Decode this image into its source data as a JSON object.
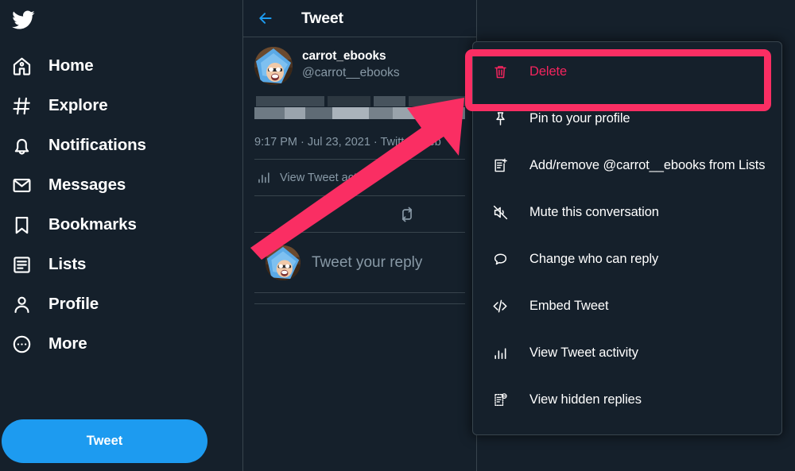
{
  "app": {
    "name": "Twitter",
    "theme": "dim-dark",
    "colors": {
      "background": "#15202b",
      "border": "#38444d",
      "accent_blue": "#1d9bf0",
      "text_primary": "#ffffff",
      "text_secondary": "#8899a6",
      "danger": "#f4245e",
      "annotation_pink": "#fa2e63"
    }
  },
  "sidebar": {
    "logo_icon": "twitter-bird-icon",
    "items": [
      {
        "label": "Home",
        "icon": "home-icon"
      },
      {
        "label": "Explore",
        "icon": "hashtag-icon"
      },
      {
        "label": "Notifications",
        "icon": "bell-icon"
      },
      {
        "label": "Messages",
        "icon": "envelope-icon"
      },
      {
        "label": "Bookmarks",
        "icon": "bookmark-icon"
      },
      {
        "label": "Lists",
        "icon": "list-icon"
      },
      {
        "label": "Profile",
        "icon": "person-icon"
      },
      {
        "label": "More",
        "icon": "ellipsis-circle-icon"
      }
    ],
    "compose_button": "Tweet"
  },
  "header": {
    "back_icon": "back-arrow-icon",
    "title": "Tweet"
  },
  "tweet": {
    "author_display_name": "carrot_ebooks",
    "author_handle": "@carrot__ebooks",
    "avatar_icon": "user-avatar",
    "body_status": "censored",
    "timestamp": "9:17 PM · Jul 23, 2021 · Twitter Web",
    "activity_link": "View Tweet activity",
    "activity_icon": "bar-chart-icon",
    "actions": [
      {
        "name": "reply",
        "icon": "speech-bubble-icon"
      },
      {
        "name": "retweet",
        "icon": "retweet-icon"
      }
    ]
  },
  "reply_composer": {
    "placeholder": "Tweet your reply",
    "avatar_icon": "user-avatar"
  },
  "dropdown_menu": {
    "items": [
      {
        "label": "Delete",
        "icon": "trash-icon",
        "danger": true
      },
      {
        "label": "Pin to your profile",
        "icon": "pin-icon",
        "danger": false
      },
      {
        "label": "Add/remove @carrot__ebooks from Lists",
        "icon": "list-add-icon",
        "danger": false
      },
      {
        "label": "Mute this conversation",
        "icon": "mute-icon",
        "danger": false
      },
      {
        "label": "Change who can reply",
        "icon": "speech-bubble-icon",
        "danger": false
      },
      {
        "label": "Embed Tweet",
        "icon": "code-brackets-icon",
        "danger": false
      },
      {
        "label": "View Tweet activity",
        "icon": "bar-chart-icon",
        "danger": false
      },
      {
        "label": "View hidden replies",
        "icon": "hidden-replies-icon",
        "danger": false
      }
    ]
  },
  "annotation": {
    "highlight_target": "Delete",
    "arrow_from": "tweet-body",
    "arrow_to": "delete-menu-item",
    "color": "#fa2e63"
  }
}
